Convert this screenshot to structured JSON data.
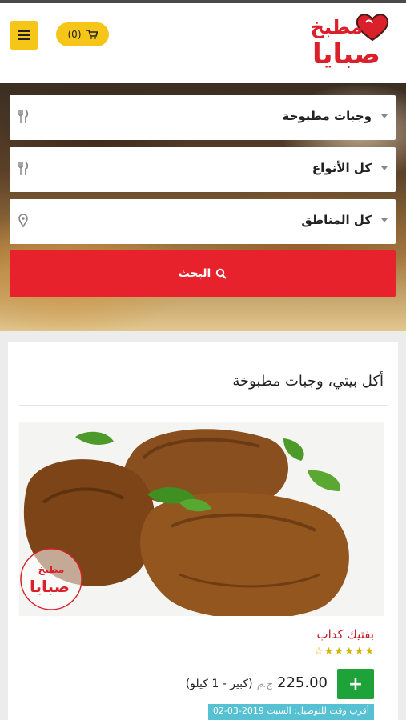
{
  "header": {
    "cart_label": "(0)",
    "logo_line1": "مطبخ",
    "logo_line2": "صبايا",
    "brand_color": "#d9202b",
    "accent_color": "#f5c518"
  },
  "search": {
    "category_select": "وجبات مطبوخة",
    "type_select": "كل الأنواع",
    "area_select": "كل المناطق",
    "button_label": "البحث",
    "button_color": "#e8222c"
  },
  "section": {
    "title": "أكل بيتي، وجبات مطبوخة"
  },
  "product": {
    "name": "بفتيك كداب",
    "rating": 5,
    "rating_max": 5,
    "price": "225.00",
    "currency": "ج.م",
    "size": "(كبير - 1 كيلو)",
    "add_label": "+",
    "delivery": "أقرب وقت للتوصيل: السبت 2019-03-02",
    "watermark_line1": "مطبخ",
    "watermark_line2": "صبايا"
  },
  "icons": {
    "menu": "hamburger-icon",
    "cart": "cart-icon",
    "category": "cutlery-icon",
    "type": "cutlery-icon",
    "area": "map-marker-icon",
    "search": "search-icon",
    "star": "star-icon"
  }
}
